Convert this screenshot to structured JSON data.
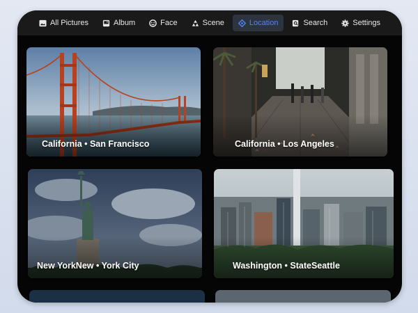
{
  "nav": {
    "tabs": [
      {
        "label": "All Pictures",
        "icon": "image-icon"
      },
      {
        "label": "Album",
        "icon": "album-icon"
      },
      {
        "label": "Face",
        "icon": "face-icon"
      },
      {
        "label": "Scene",
        "icon": "scene-icon"
      },
      {
        "label": "Location",
        "icon": "location-icon",
        "active": true
      },
      {
        "label": "Search",
        "icon": "search-icon"
      },
      {
        "label": "Settings",
        "icon": "gear-icon"
      }
    ]
  },
  "locations": [
    {
      "label": "California • San Francisco",
      "photo": "golden gate bridge"
    },
    {
      "label": "California • Los Angeles",
      "photo": "hollywood walk of fame"
    },
    {
      "label": "New YorkNew • York City",
      "photo": "statue of liberty"
    },
    {
      "label": "Washington • StateSeattle",
      "photo": "seattle skyline"
    }
  ],
  "colors": {
    "accent": "#4e86f5",
    "background": "#050505",
    "topbar": "#1a1a1a"
  }
}
